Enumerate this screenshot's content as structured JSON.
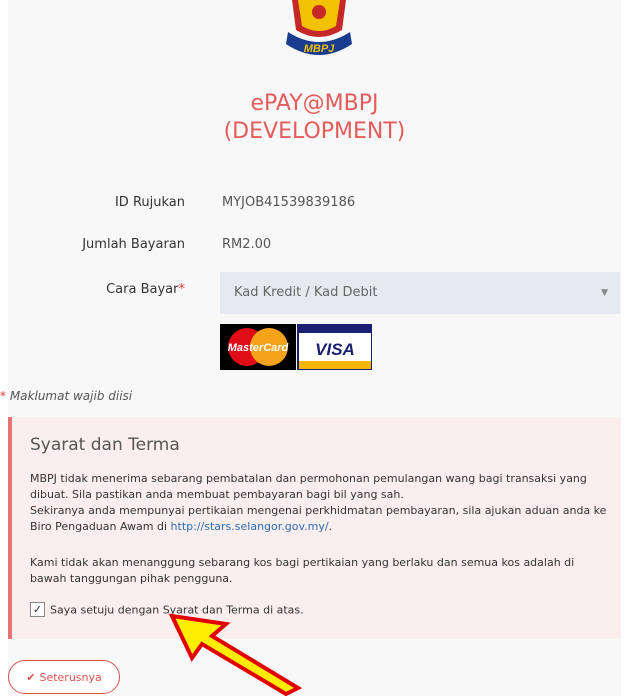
{
  "header": {
    "logo_text": "MBPJ",
    "title_line1": "ePAY@MBPJ",
    "title_line2": "(DEVELOPMENT)"
  },
  "form": {
    "ref_label": "ID Rujukan",
    "ref_value": "MYJOB41539839186",
    "amount_label": "Jumlah Bayaran",
    "amount_value": "RM2.00",
    "method_label": "Cara Bayar",
    "required_mark": "*",
    "method_value": "Kad Kredit / Kad Debit",
    "card_logos": [
      "MasterCard",
      "VISA"
    ]
  },
  "mandatory_note": {
    "mark": "*",
    "text": "Maklumat wajib diisi"
  },
  "terms": {
    "title": "Syarat dan Terma",
    "p1": "MBPJ tidak menerima sebarang pembatalan dan permohonan pemulangan wang bagi transaksi yang dibuat. Sila pastikan anda membuat pembayaran bagi bil yang sah.",
    "p2_prefix": "Sekiranya anda mempunyai pertikaian mengenai perkhidmatan pembayaran, sila ajukan aduan anda ke Biro Pengaduan Awam di",
    "p2_link": "http://stars.selangor.gov.my/",
    "p2_suffix": ".",
    "p3": "Kami tidak akan menanggung sebarang kos bagi pertikaian yang berlaku dan semua kos adalah di bawah tanggungan pihak pengguna.",
    "agree_label": "Saya setuju dengan Syarat dan Terma di atas.",
    "agree_checked": true
  },
  "actions": {
    "next_label": "Seterusnya"
  },
  "colors": {
    "accent": "#e55b5b",
    "terms_bg": "#fbeeee",
    "terms_border": "#e57373",
    "arrow_fill": "#ffee00",
    "arrow_stroke": "#e00000"
  }
}
